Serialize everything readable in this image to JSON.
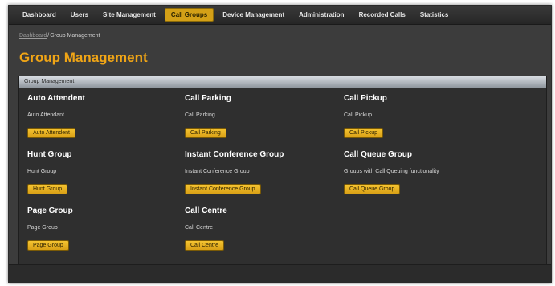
{
  "nav": {
    "items": [
      {
        "label": "Dashboard",
        "active": false
      },
      {
        "label": "Users",
        "active": false
      },
      {
        "label": "Site Management",
        "active": false
      },
      {
        "label": "Call Groups",
        "active": true
      },
      {
        "label": "Device Management",
        "active": false
      },
      {
        "label": "Administration",
        "active": false
      },
      {
        "label": "Recorded Calls",
        "active": false
      },
      {
        "label": "Statistics",
        "active": false
      }
    ]
  },
  "breadcrumb": {
    "home": "Dashboard",
    "separator": "/",
    "current": "Group Management"
  },
  "page": {
    "title": "Group Management"
  },
  "panel": {
    "header": "Group Management",
    "groups": [
      {
        "title": "Auto Attendent",
        "description": "Auto Attendant",
        "button": "Auto Attendent"
      },
      {
        "title": "Call Parking",
        "description": "Call Parking",
        "button": "Call Parking"
      },
      {
        "title": "Call Pickup",
        "description": "Call Pickup",
        "button": "Call Pickup"
      },
      {
        "title": "Hunt Group",
        "description": "Hunt Group",
        "button": "Hunt Group"
      },
      {
        "title": "Instant Conference Group",
        "description": "Instant Conference Group",
        "button": "Instant Conference Group"
      },
      {
        "title": "Call Queue Group",
        "description": "Groups with Call Queuing functionality",
        "button": "Call Queue Group"
      },
      {
        "title": "Page Group",
        "description": "Page Group",
        "button": "Page Group"
      },
      {
        "title": "Call Centre",
        "description": "Call Centre",
        "button": "Call Centre"
      }
    ]
  },
  "colors": {
    "accent": "#f0a516",
    "button": "#e8b224",
    "background": "#3c3c3c"
  }
}
